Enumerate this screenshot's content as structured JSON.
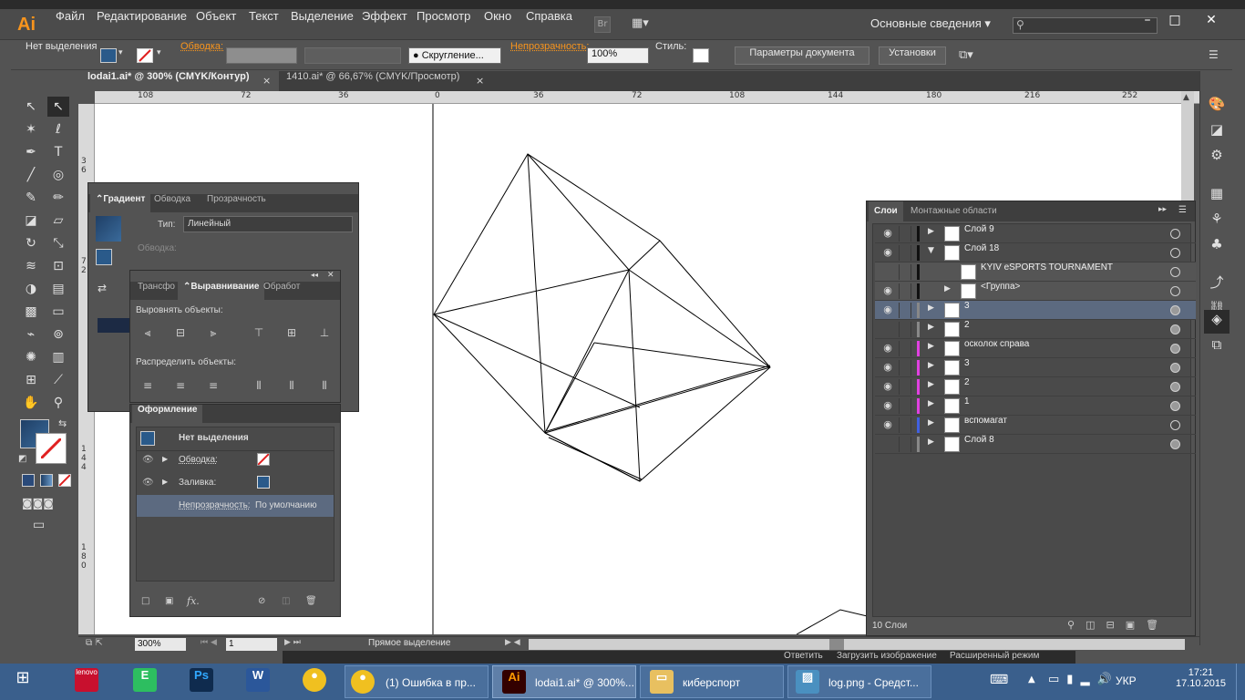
{
  "menubar": {
    "app_logo": "Ai",
    "items": [
      "Файл",
      "Редактирование",
      "Объект",
      "Текст",
      "Выделение",
      "Эффект",
      "Просмотр",
      "Окно",
      "Справка"
    ],
    "bridge": "Br",
    "workspace": "Основные сведения",
    "window_buttons": [
      "–",
      "□",
      "✕"
    ]
  },
  "controlbar": {
    "selection": "Нет выделения",
    "stroke_label": "Обводка:",
    "brush_label": "Скругление...",
    "opacity_label": "Непрозрачность:",
    "opacity_value": "100%",
    "style_label": "Стиль:",
    "doc_params": "Параметры документа",
    "settings": "Установки"
  },
  "doctabs": [
    {
      "label": "lodai1.ai* @ 300% (CMYK/Контур)",
      "close": "×"
    },
    {
      "label": "1410.ai* @ 66,67% (CMYK/Просмотр)",
      "close": "×"
    }
  ],
  "hruler": [
    "108",
    "72",
    "36",
    "0",
    "36",
    "72",
    "108",
    "144",
    "180",
    "216",
    "252"
  ],
  "vruler": [
    "3 6",
    "7 2",
    "1 4 4",
    "1 8 0"
  ],
  "gradient_panel": {
    "tabs": [
      "Градиент",
      "Обводка",
      "Прозрачность"
    ],
    "type_label": "Тип:",
    "type_value": "Линейный",
    "stroke_label": "Обводка:"
  },
  "align_panel": {
    "tabs": [
      "Трансфо",
      "Выравнивание",
      "Обработ"
    ],
    "align_title": "Выровнять объекты:",
    "distribute_title": "Распределить объекты:"
  },
  "appearance_panel": {
    "title": "Оформление",
    "selection": "Нет выделения",
    "rows": [
      {
        "label": "Обводка:"
      },
      {
        "label": "Заливка:"
      },
      {
        "label": "Непрозрачность:",
        "value": "По умолчанию"
      }
    ]
  },
  "layers_panel": {
    "tabs": [
      "Слои",
      "Монтажные области"
    ],
    "rows": [
      {
        "name": "Слой 9",
        "visible": true,
        "color": "#111111",
        "expanded": false,
        "indent": 0
      },
      {
        "name": "Слой 18",
        "visible": true,
        "color": "#111111",
        "expanded": true,
        "indent": 0
      },
      {
        "name": "KYIV eSPORTS TOURNAMENT",
        "visible": false,
        "color": "#111111",
        "expanded": null,
        "indent": 1
      },
      {
        "name": "<Группа>",
        "visible": true,
        "color": "#111111",
        "expanded": false,
        "indent": 1
      },
      {
        "name": "3",
        "visible": true,
        "color": "#888888",
        "expanded": false,
        "indent": 0,
        "selected": true
      },
      {
        "name": "2",
        "visible": false,
        "color": "#888888",
        "expanded": false,
        "indent": 0
      },
      {
        "name": "осколок справа",
        "visible": true,
        "color": "#e040e0",
        "expanded": false,
        "indent": 0
      },
      {
        "name": "3",
        "visible": true,
        "color": "#e040e0",
        "expanded": false,
        "indent": 0
      },
      {
        "name": "2",
        "visible": true,
        "color": "#e040e0",
        "expanded": false,
        "indent": 0
      },
      {
        "name": "1",
        "visible": true,
        "color": "#e040e0",
        "expanded": false,
        "indent": 0
      },
      {
        "name": "вспомагат",
        "visible": true,
        "color": "#4060e0",
        "expanded": false,
        "indent": 0
      },
      {
        "name": "Слой 8",
        "visible": false,
        "color": "#888888",
        "expanded": false,
        "indent": 0
      }
    ],
    "footer": "10 Слои"
  },
  "statusbar": {
    "zoom": "300%",
    "page": "1",
    "tool": "Прямое выделение"
  },
  "behind": [
    "Ответить",
    "Загрузить изображение",
    "Расширенный режим"
  ],
  "taskbar": {
    "items": [
      {
        "label": "(1) Ошибка в пр...",
        "icon": "chrome-icon"
      },
      {
        "label": "lodai1.ai* @ 300%...",
        "icon": "illustrator-icon"
      },
      {
        "label": "киберспорт",
        "icon": "folder-icon"
      },
      {
        "label": "log.png - Средст...",
        "icon": "image-icon"
      }
    ],
    "lang": "УКР",
    "time": "17:21",
    "date": "17.10.2015"
  }
}
